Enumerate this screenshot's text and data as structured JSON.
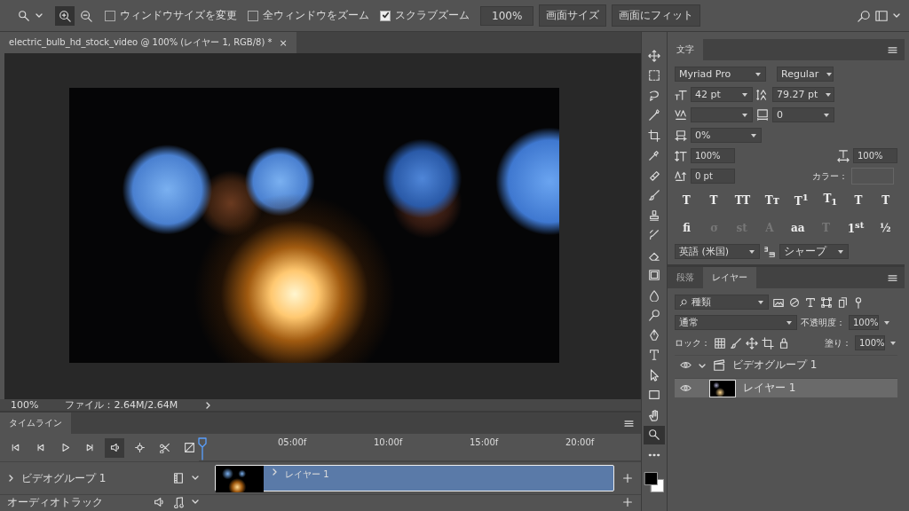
{
  "options_bar": {
    "zoom_modes": [
      {
        "kind": "in",
        "selected": true
      },
      {
        "kind": "out",
        "selected": false
      }
    ],
    "checkboxes": [
      {
        "label": "ウィンドウサイズを変更",
        "checked": false
      },
      {
        "label": "全ウィンドウをズーム",
        "checked": false
      },
      {
        "label": "スクラブズーム",
        "checked": true
      }
    ],
    "zoom_value": "100%",
    "buttons": [
      "画面サイズ",
      "画面にフィット"
    ]
  },
  "document_tab": {
    "title": "electric_bulb_hd_stock_video @ 100% (レイヤー 1, RGB/8) *",
    "close": "×"
  },
  "status_bar": {
    "zoom": "100%",
    "file_info": "ファイル：2.64M/2.64M"
  },
  "timeline": {
    "tab": "タイムライン",
    "controls": [
      {
        "kind": "first",
        "selected": false
      },
      {
        "kind": "prev",
        "selected": false
      },
      {
        "kind": "play",
        "selected": false
      },
      {
        "kind": "next",
        "selected": false
      },
      {
        "kind": "audio",
        "selected": true
      },
      {
        "kind": "settings",
        "selected": false
      },
      {
        "kind": "split",
        "selected": false
      },
      {
        "kind": "transition",
        "selected": false
      }
    ],
    "ruler": [
      "05:00f",
      "10:00f",
      "15:00f",
      "20:00f"
    ],
    "tracks": [
      {
        "kind": "video",
        "name": "ビデオグループ 1",
        "clip": "レイヤー 1"
      },
      {
        "kind": "audio",
        "name": "オーディオトラック"
      }
    ]
  },
  "toolbar": {
    "tools": [
      {
        "kind": "move",
        "selected": false
      },
      {
        "kind": "marquee",
        "selected": false
      },
      {
        "kind": "lasso",
        "selected": false
      },
      {
        "kind": "wand",
        "selected": false
      },
      {
        "kind": "crop",
        "selected": false
      },
      {
        "kind": "eyedropper",
        "selected": false
      },
      {
        "kind": "healing",
        "selected": false
      },
      {
        "kind": "brush",
        "selected": false
      },
      {
        "kind": "stamp",
        "selected": false
      },
      {
        "kind": "history",
        "selected": false
      },
      {
        "kind": "eraser",
        "selected": false
      },
      {
        "kind": "gradient",
        "selected": false
      },
      {
        "kind": "blur",
        "selected": false
      },
      {
        "kind": "dodge",
        "selected": false
      },
      {
        "kind": "pen",
        "selected": false
      },
      {
        "kind": "type",
        "selected": false
      },
      {
        "kind": "select",
        "selected": false
      },
      {
        "kind": "rect",
        "selected": false
      },
      {
        "kind": "hand",
        "selected": false
      },
      {
        "kind": "zoom",
        "selected": true
      },
      {
        "kind": "more",
        "selected": false
      }
    ]
  },
  "character_panel": {
    "tab": "文字",
    "font": "Myriad Pro",
    "style": "Regular",
    "size": "42 pt",
    "leading": "79.27 pt",
    "tracking": "0",
    "tsume": "0%",
    "vscale": "100%",
    "hscale": "100%",
    "baseline": "0 pt",
    "color_label": "カラー：",
    "style_buttons": [
      {
        "label": "T",
        "disabled": false
      },
      {
        "label": "T",
        "disabled": false
      },
      {
        "label": "TT",
        "disabled": false
      },
      {
        "label": "Tт",
        "disabled": false
      },
      {
        "label": "T$^{1}$",
        "disabled": false
      },
      {
        "label": "T$_{1}$",
        "disabled": false
      },
      {
        "label": "T",
        "disabled": false
      },
      {
        "label": "T",
        "disabled": false
      }
    ],
    "opentype_buttons": [
      {
        "label": "fi",
        "disabled": false
      },
      {
        "label": "σ",
        "disabled": true
      },
      {
        "label": "st",
        "disabled": true
      },
      {
        "label": "A",
        "disabled": true
      },
      {
        "label": "aa",
        "disabled": false
      },
      {
        "label": "T",
        "disabled": true
      },
      {
        "label": "1$^{st}$",
        "disabled": false
      },
      {
        "label": "½",
        "disabled": false
      }
    ],
    "language": "英語 (米国)",
    "antialias": "シャープ"
  },
  "layers_panel": {
    "tabs": [
      {
        "label": "段落",
        "selected": false
      },
      {
        "label": "レイヤー",
        "selected": true
      }
    ],
    "filter": "種類",
    "blend_mode": "通常",
    "opacity_label": "不透明度：",
    "opacity": "100%",
    "lock_label": "ロック：",
    "fill_label": "塗り：",
    "fill": "100%",
    "layers": [
      {
        "name": "ビデオグループ 1",
        "visible": true,
        "expanded": true,
        "selected": false,
        "children": [
          {
            "name": "レイヤー 1",
            "visible": true,
            "selected": true
          }
        ]
      }
    ]
  }
}
